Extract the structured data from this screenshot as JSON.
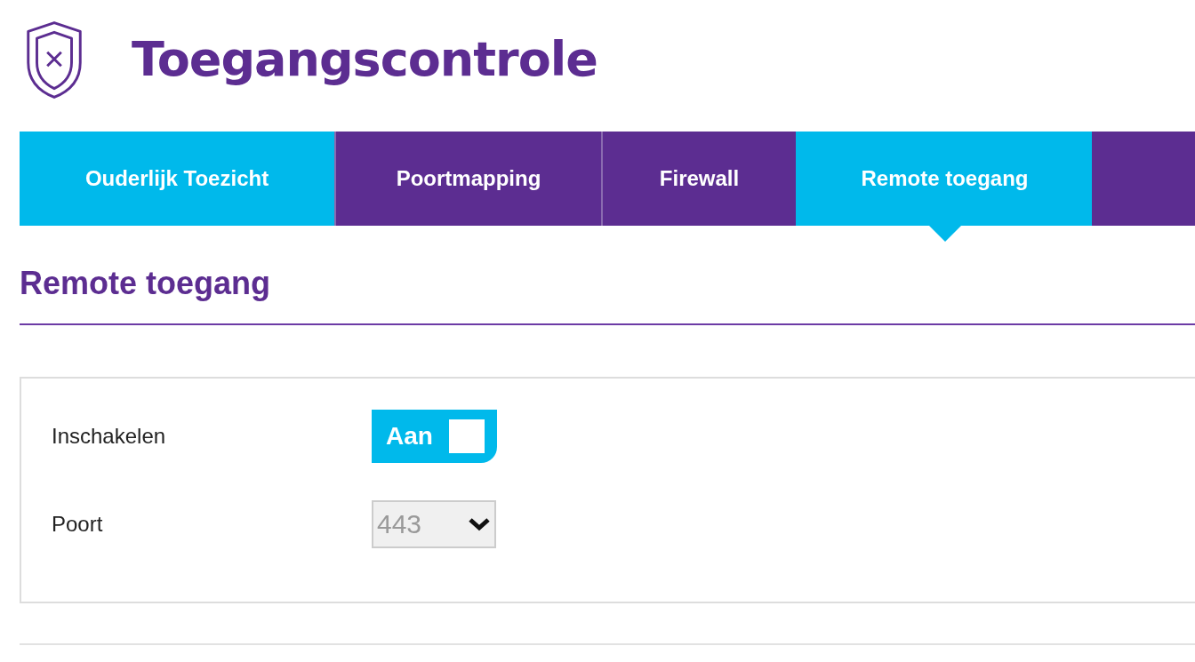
{
  "page": {
    "title": "Toegangscontrole"
  },
  "tabs": [
    {
      "label": "Ouderlijk Toezicht",
      "selected": false,
      "highlighted": true
    },
    {
      "label": "Poortmapping",
      "selected": false,
      "highlighted": false
    },
    {
      "label": "Firewall",
      "selected": false,
      "highlighted": false
    },
    {
      "label": "Remote toegang",
      "selected": true,
      "highlighted": true
    }
  ],
  "section": {
    "heading": "Remote toegang"
  },
  "settings": [
    {
      "kind": "toggle",
      "label": "Inschakelen",
      "value": "Aan",
      "on": true
    },
    {
      "kind": "select",
      "label": "Poort",
      "value": "443",
      "disabled": true
    }
  ]
}
